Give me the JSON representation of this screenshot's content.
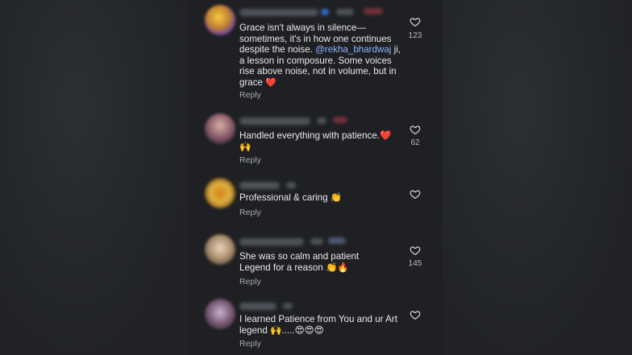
{
  "colors": {
    "background": "#1e2023",
    "text": "#eaeaea",
    "mention": "#8fb3ff",
    "secondary": "#a6a8ad",
    "heart_emoji": "#e63946"
  },
  "comments": [
    {
      "text_parts": [
        "Grace isn't always in silence—sometimes, it's in how one continues despite the noise. ",
        "@rekha_bhardwaj",
        " ji, a lesson in composure. Some voices rise above noise, not in volume, but in grace ",
        "❤️"
      ],
      "reply_label": "Reply",
      "like_icon": "heart-outline-icon",
      "like_count": "123"
    },
    {
      "text": "Handled everything with patience.❤️🙌",
      "reply_label": "Reply",
      "like_icon": "heart-outline-icon",
      "like_count": "62"
    },
    {
      "text": "Professional & caring 👏",
      "reply_label": "Reply",
      "like_icon": "heart-outline-icon",
      "like_count": ""
    },
    {
      "text": "She was so calm and patient Legend for a reason 👏🔥",
      "reply_label": "Reply",
      "like_icon": "heart-outline-icon",
      "like_count": "145"
    },
    {
      "text": "I learned Patience from You and ur Art legend 🙌.....😍😍😍",
      "reply_label": "Reply",
      "like_icon": "heart-outline-icon",
      "like_count": ""
    }
  ]
}
